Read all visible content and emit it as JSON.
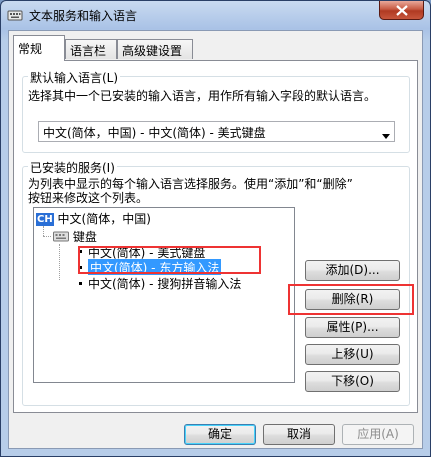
{
  "window": {
    "title": "文本服务和输入语言"
  },
  "tabs": [
    {
      "label": "常规"
    },
    {
      "label": "语言栏"
    },
    {
      "label": "高级键设置"
    }
  ],
  "default_language": {
    "group_title": "默认输入语言(L)",
    "description": "选择其中一个已安装的输入语言，用作所有输入字段的默认语言。",
    "selected_value": "中文(简体，中国) - 中文(简体) - 美式键盘"
  },
  "installed_services": {
    "group_title": "已安装的服务(I)",
    "description_line1": "为列表中显示的每个输入语言选择服务。使用“添加”和“删除”",
    "description_line2": "按钮来修改这个列表。",
    "language_badge": "CH",
    "language": "中文(简体，中国)",
    "category": "键盘",
    "items": [
      "中文(简体) - 美式键盘",
      "中文(简体) - 东方输入法",
      "中文(简体) - 搜狗拼音输入法"
    ],
    "selected_index": 1
  },
  "side_buttons": {
    "add": "添加(D)...",
    "remove": "删除(R)",
    "properties": "属性(P)...",
    "move_up": "上移(U)",
    "move_down": "下移(O)"
  },
  "footer_buttons": {
    "ok": "确定",
    "cancel": "取消",
    "apply": "应用(A)"
  },
  "colors": {
    "highlight": "#3399ff",
    "annotation_red": "#e33333"
  }
}
